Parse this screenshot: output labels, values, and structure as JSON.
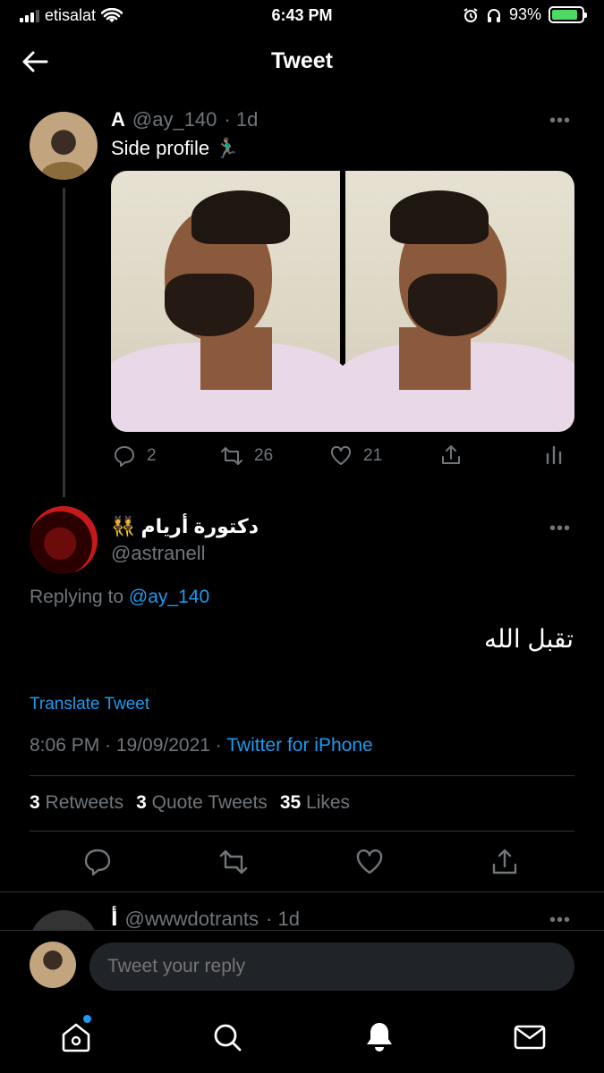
{
  "status_bar": {
    "carrier": "etisalat",
    "time": "6:43 PM",
    "battery": "93%"
  },
  "header": {
    "title": "Tweet"
  },
  "original_tweet": {
    "name": "A",
    "handle": "@ay_140",
    "age": "· 1d",
    "text": "Side profile 🏃🏽‍♂️",
    "replies": "2",
    "retweets": "26",
    "likes": "21",
    "more": "•••"
  },
  "reply_tweet": {
    "name": "دكتورة أريام 👯",
    "handle": "@astranell",
    "replying_prefix": "Replying to ",
    "replying_to": "@ay_140",
    "body": "تقبل الله",
    "translate": "Translate Tweet",
    "timestamp": "8:06 PM · 19/09/2021 · ",
    "source": "Twitter for iPhone",
    "more": "•••",
    "stats": {
      "retweets_count": "3",
      "retweets_label": "Retweets",
      "quotes_count": "3",
      "quotes_label": "Quote Tweets",
      "likes_count": "35",
      "likes_label": "Likes"
    }
  },
  "next_tweet": {
    "name": "أ",
    "handle": "@wwwdotrants",
    "age": "· 1d",
    "more": "•••"
  },
  "composer": {
    "placeholder": "Tweet your reply"
  },
  "tabbar": {
    "icons": [
      "home-icon",
      "search-icon",
      "notifications-icon",
      "messages-icon"
    ]
  }
}
